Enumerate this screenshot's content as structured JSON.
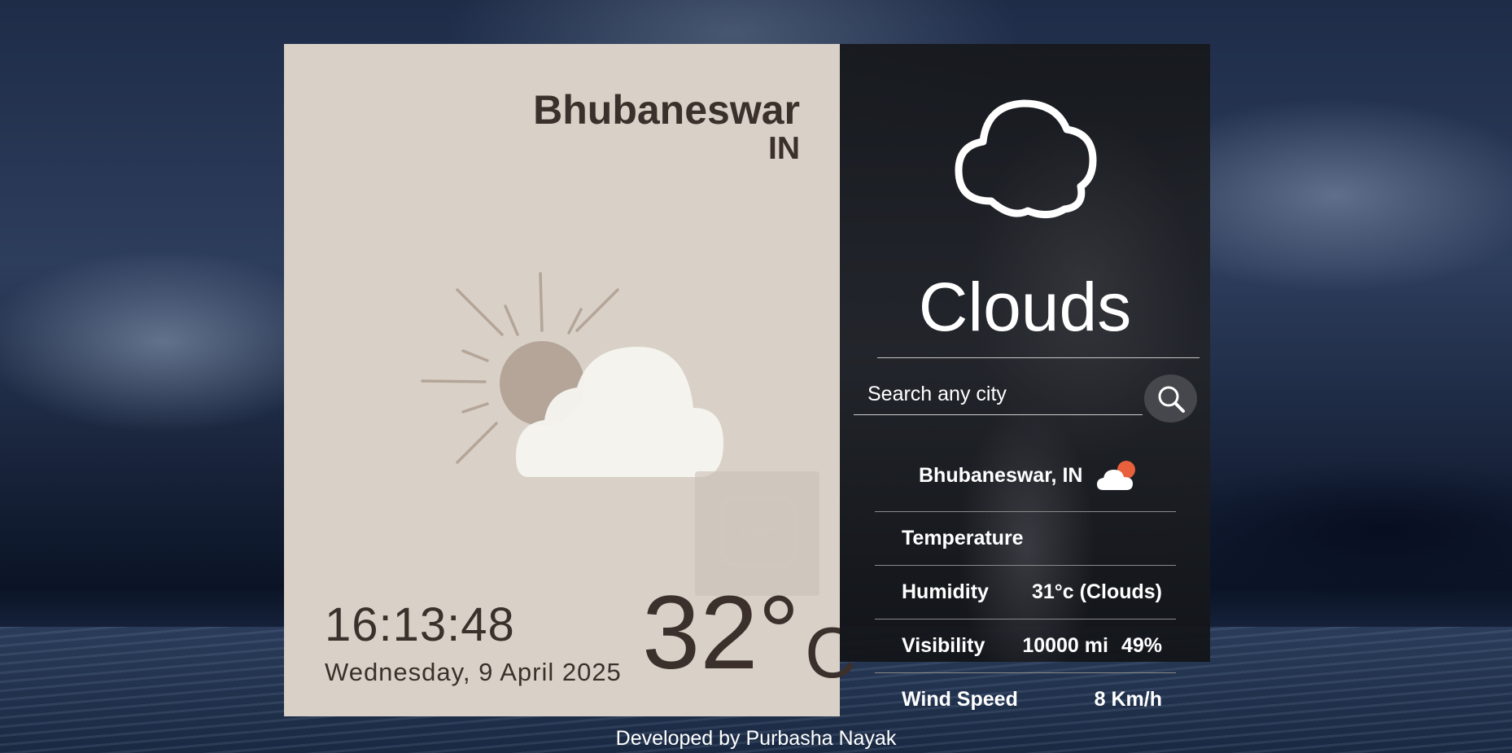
{
  "location": {
    "city": "Bhubaneswar",
    "country": "IN"
  },
  "time": {
    "clock": "16:13:48",
    "date": "Wednesday, 9 April 2025"
  },
  "temperature": {
    "value": "32°",
    "unit": "C"
  },
  "weather": {
    "condition": "Clouds"
  },
  "search": {
    "placeholder": "Search any city"
  },
  "result": {
    "location_label": "Bhubaneswar, IN"
  },
  "stats": {
    "temperature": {
      "label": "Temperature"
    },
    "humidity": {
      "label": "Humidity",
      "value": "31°c (Clouds)"
    },
    "visibility": {
      "label": "Visibility",
      "value": "10000 mi",
      "extra": "49%"
    },
    "wind": {
      "label": "Wind Speed",
      "value": "8 Km/h"
    }
  },
  "footer": {
    "credit": "Developed by Purbasha Nayak"
  },
  "icons": {
    "main": "sun-behind-cloud-icon",
    "condition": "cloud-outline-icon",
    "search": "search-icon",
    "small": "cloud-sun-icon",
    "widget": "keyboard-icon"
  },
  "colors": {
    "left_card": "#d9d1c7",
    "text_dark": "#3b302b",
    "right_card": "#1c1e22",
    "sun": "#b4a598",
    "cloud": "#f6f4f0",
    "accent_sun": "#e8603c"
  }
}
